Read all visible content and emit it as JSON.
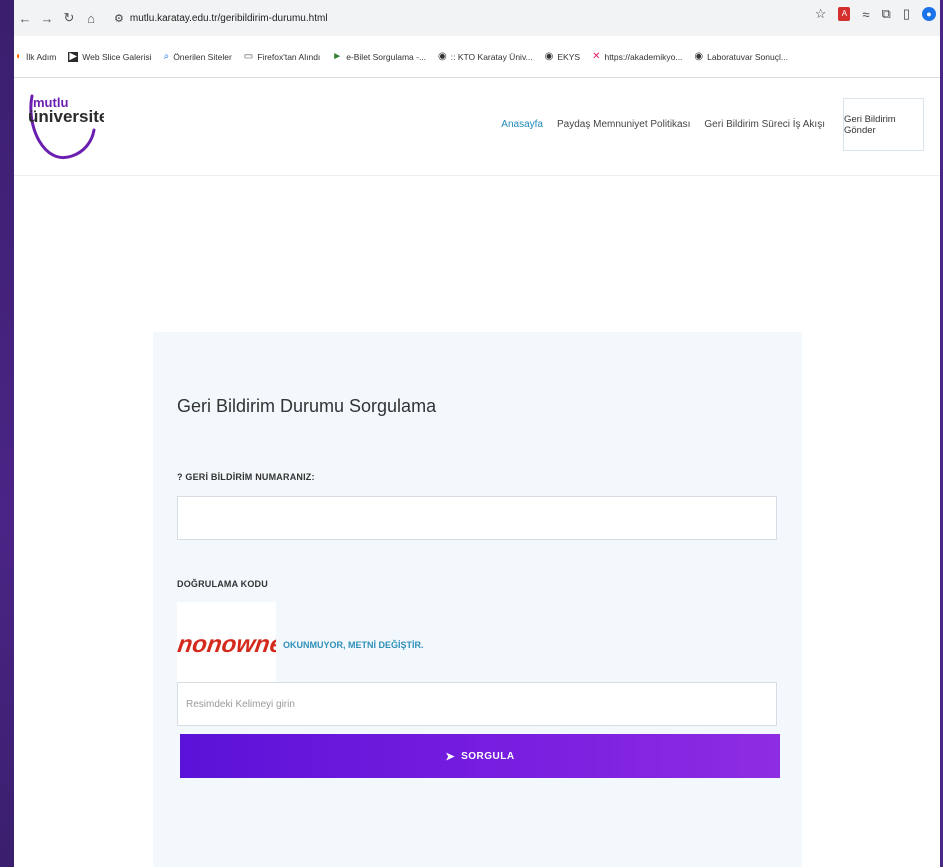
{
  "browser": {
    "url": "mutlu.karatay.edu.tr/geribildirim-durumu.html",
    "nav_icons": [
      "back-arrow-icon",
      "forward-arrow-icon",
      "reload-icon",
      "home-icon"
    ],
    "bookmarks": [
      {
        "label": "İlk Adım",
        "icon": "firefox-icon"
      },
      {
        "label": "Web Slice Galerisi",
        "icon": "web-slice-icon"
      },
      {
        "label": "Önerilen Siteler",
        "icon": "search-icon"
      },
      {
        "label": "Firefox'tan Alındı",
        "icon": "folder-icon"
      },
      {
        "label": "e-Bilet Sorgulama -...",
        "icon": "play-icon"
      },
      {
        "label": ":: KTO Karatay Üniv...",
        "icon": "globe-icon"
      },
      {
        "label": "EKYS",
        "icon": "globe-icon"
      },
      {
        "label": "https://akademikyo...",
        "icon": "m-icon"
      },
      {
        "label": "Laboratuvar Sonuçl...",
        "icon": "globe-icon"
      }
    ]
  },
  "site": {
    "logo_top": "mutlu",
    "logo_bottom": "üniversite",
    "brand_color": "#6b1fb1",
    "nav": [
      {
        "label": "Anasayfa",
        "active": true
      },
      {
        "label": "Paydaş Memnuniyet Politikası",
        "active": false
      },
      {
        "label": "Geri Bildirim Süreci İş Akışı",
        "active": false
      }
    ],
    "cta": "Geri Bildirim Gönder"
  },
  "form": {
    "title": "Geri Bildirim Durumu Sorgulama",
    "number_label": "? GERİ BİLDİRİM NUMARANIZ:",
    "number_value": "",
    "code_label": "DOĞRULAMA KODU",
    "captcha_text": "nonowner",
    "captcha_refresh": "OKUNMUYOR, METNİ DEĞİŞTİR.",
    "captcha_placeholder": "Resimdeki Kelimeyi girin",
    "submit_label": "SORGULA",
    "accent_color": "#2f8fb9",
    "button_gradient": [
      "#5b12d8",
      "#8e2de2"
    ]
  }
}
